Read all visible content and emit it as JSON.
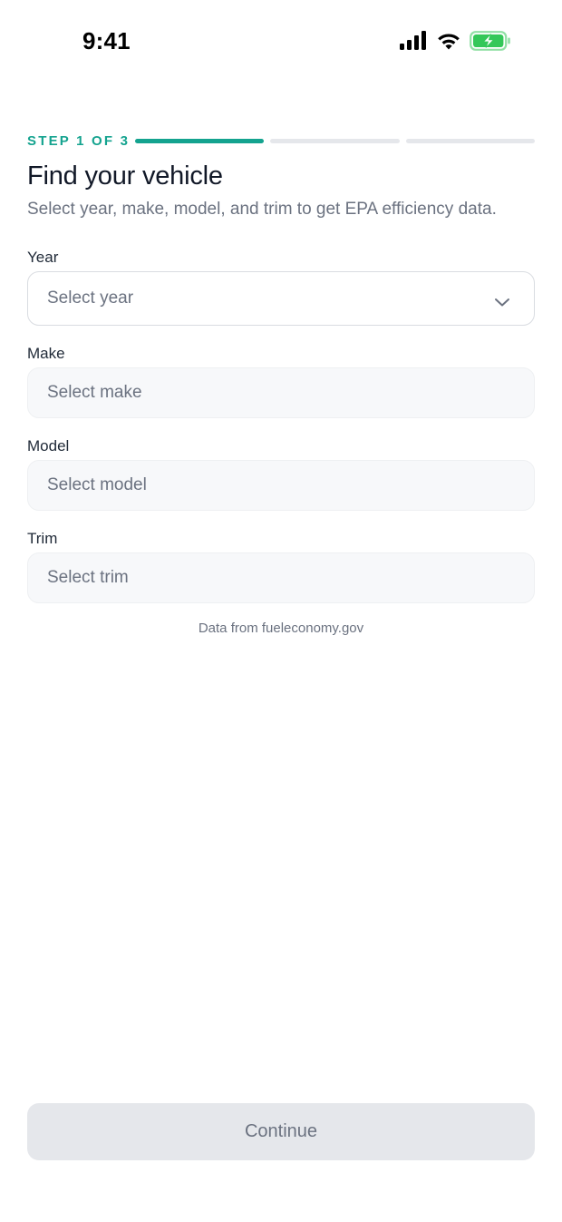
{
  "status_bar": {
    "time": "9:41",
    "icons": [
      "cellular-signal-icon",
      "wifi-icon",
      "battery-charging-icon"
    ]
  },
  "progress": {
    "label": "STEP 1 OF 3",
    "current_step": 1,
    "total_steps": 3
  },
  "header": {
    "title": "Find your vehicle",
    "subtitle": "Select year, make, model, and trim to get EPA efficiency data."
  },
  "form": {
    "year": {
      "label": "Year",
      "placeholder": "Select year",
      "value": "",
      "enabled": true
    },
    "make": {
      "label": "Make",
      "placeholder": "Select make",
      "value": "",
      "enabled": false
    },
    "model": {
      "label": "Model",
      "placeholder": "Select model",
      "value": "",
      "enabled": false
    },
    "trim": {
      "label": "Trim",
      "placeholder": "Select trim",
      "value": "",
      "enabled": false
    }
  },
  "source_note": "Data from fueleconomy.gov",
  "continue_button": {
    "label": "Continue",
    "enabled": false
  },
  "colors": {
    "accent": "#14a38f",
    "track": "#e5e7eb",
    "battery_fill": "#34c759"
  }
}
